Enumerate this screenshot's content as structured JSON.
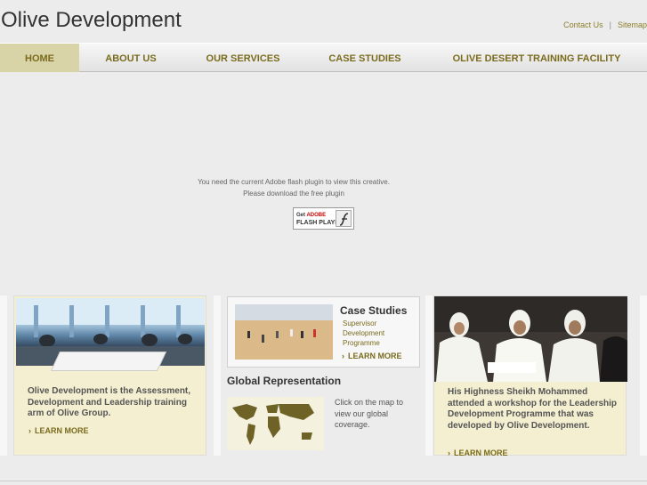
{
  "header": {
    "logo_text": "Olive Development",
    "utility_links": [
      {
        "label": "Contact Us"
      },
      {
        "label": "Sitemap"
      }
    ],
    "separator": "|"
  },
  "nav": {
    "items": [
      {
        "label": "HOME",
        "active": true
      },
      {
        "label": "ABOUT US",
        "active": false
      },
      {
        "label": "OUR SERVICES",
        "active": false
      },
      {
        "label": "CASE STUDIES",
        "active": false
      },
      {
        "label": "OLIVE DESERT TRAINING FACILITY",
        "active": false
      }
    ]
  },
  "flash": {
    "message_line1": "You need the current Adobe flash plugin to view this creative.",
    "message_line2": "Please download the free plugin",
    "badge_get": "Get",
    "badge_adobe": "ADOBE",
    "badge_product": "FLASH PLAYER",
    "badge_icon": "flash-player-icon"
  },
  "panel_assessment": {
    "text": "Olive Development is the Assessment, Development and Leadership training arm of Olive Group.",
    "more_label": "LEARN MORE"
  },
  "panel_case_studies": {
    "title": "Case Studies",
    "subtitle": "Supervisor Development Programme",
    "more_label": "LEARN MORE"
  },
  "global_representation": {
    "title": "Global Representation",
    "text": "Click on the map to view our global coverage."
  },
  "panel_news": {
    "text": "His Highness Sheikh Mohammed attended a workshop for the Leadership Development Programme that was developed by Olive Development.",
    "more_label": "LEARN MORE"
  },
  "colors": {
    "accent": "#7a6b1d",
    "nav_active_bg": "#d9d3a8",
    "panel_bg": "#f3efd0",
    "page_bg": "#ececec"
  }
}
